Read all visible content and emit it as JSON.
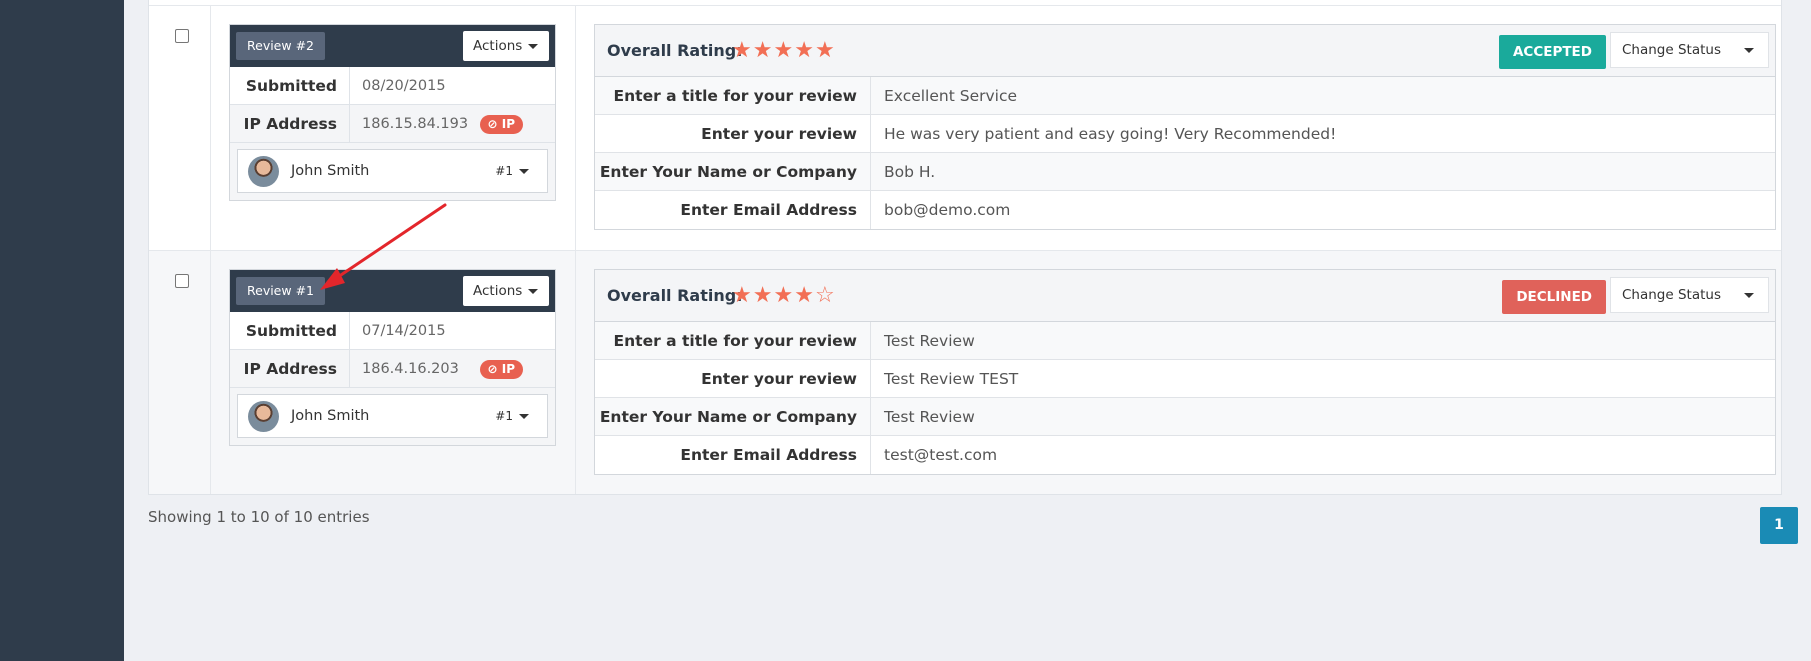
{
  "reviews": [
    {
      "tag": "Review #2",
      "actions_label": "Actions",
      "meta": [
        {
          "label": "Submitted",
          "value": "08/20/2015"
        },
        {
          "label": "IP Address",
          "value": "186.15.84.193",
          "badge": "⊘ IP"
        }
      ],
      "user": {
        "name": "John Smith",
        "number": "#1"
      },
      "rating_label": "Overall Rating:",
      "rating": 5,
      "rating_max": 5,
      "status": "ACCEPTED",
      "change_status_label": "Change Status",
      "fields": [
        {
          "label": "Enter a title for your review",
          "value": "Excellent Service"
        },
        {
          "label": "Enter your review",
          "value": "He was very patient and easy going! Very Recommended!"
        },
        {
          "label": "Enter Your Name or Company",
          "value": "Bob H."
        },
        {
          "label": "Enter Email Address",
          "value": "bob@demo.com"
        }
      ]
    },
    {
      "tag": "Review #1",
      "actions_label": "Actions",
      "meta": [
        {
          "label": "Submitted",
          "value": "07/14/2015"
        },
        {
          "label": "IP Address",
          "value": "186.4.16.203",
          "badge": "⊘ IP"
        }
      ],
      "user": {
        "name": "John Smith",
        "number": "#1"
      },
      "rating_label": "Overall Rating:",
      "rating": 4,
      "rating_max": 5,
      "status": "DECLINED",
      "change_status_label": "Change Status",
      "fields": [
        {
          "label": "Enter a title for your review",
          "value": "Test Review"
        },
        {
          "label": "Enter your review",
          "value": "Test Review TEST"
        },
        {
          "label": "Enter Your Name or Company",
          "value": "Test Review"
        },
        {
          "label": "Enter Email Address",
          "value": "test@test.com"
        }
      ]
    }
  ],
  "footer": {
    "info": "Showing 1 to 10 of 10 entries",
    "page": "1"
  },
  "colors": {
    "sidebar": "#2f3c4b",
    "accepted": "#1aaa9b",
    "declined": "#e0625a",
    "star": "#f26f55",
    "pagination": "#1a8bb5",
    "annotation_arrow": "#e3262b"
  }
}
